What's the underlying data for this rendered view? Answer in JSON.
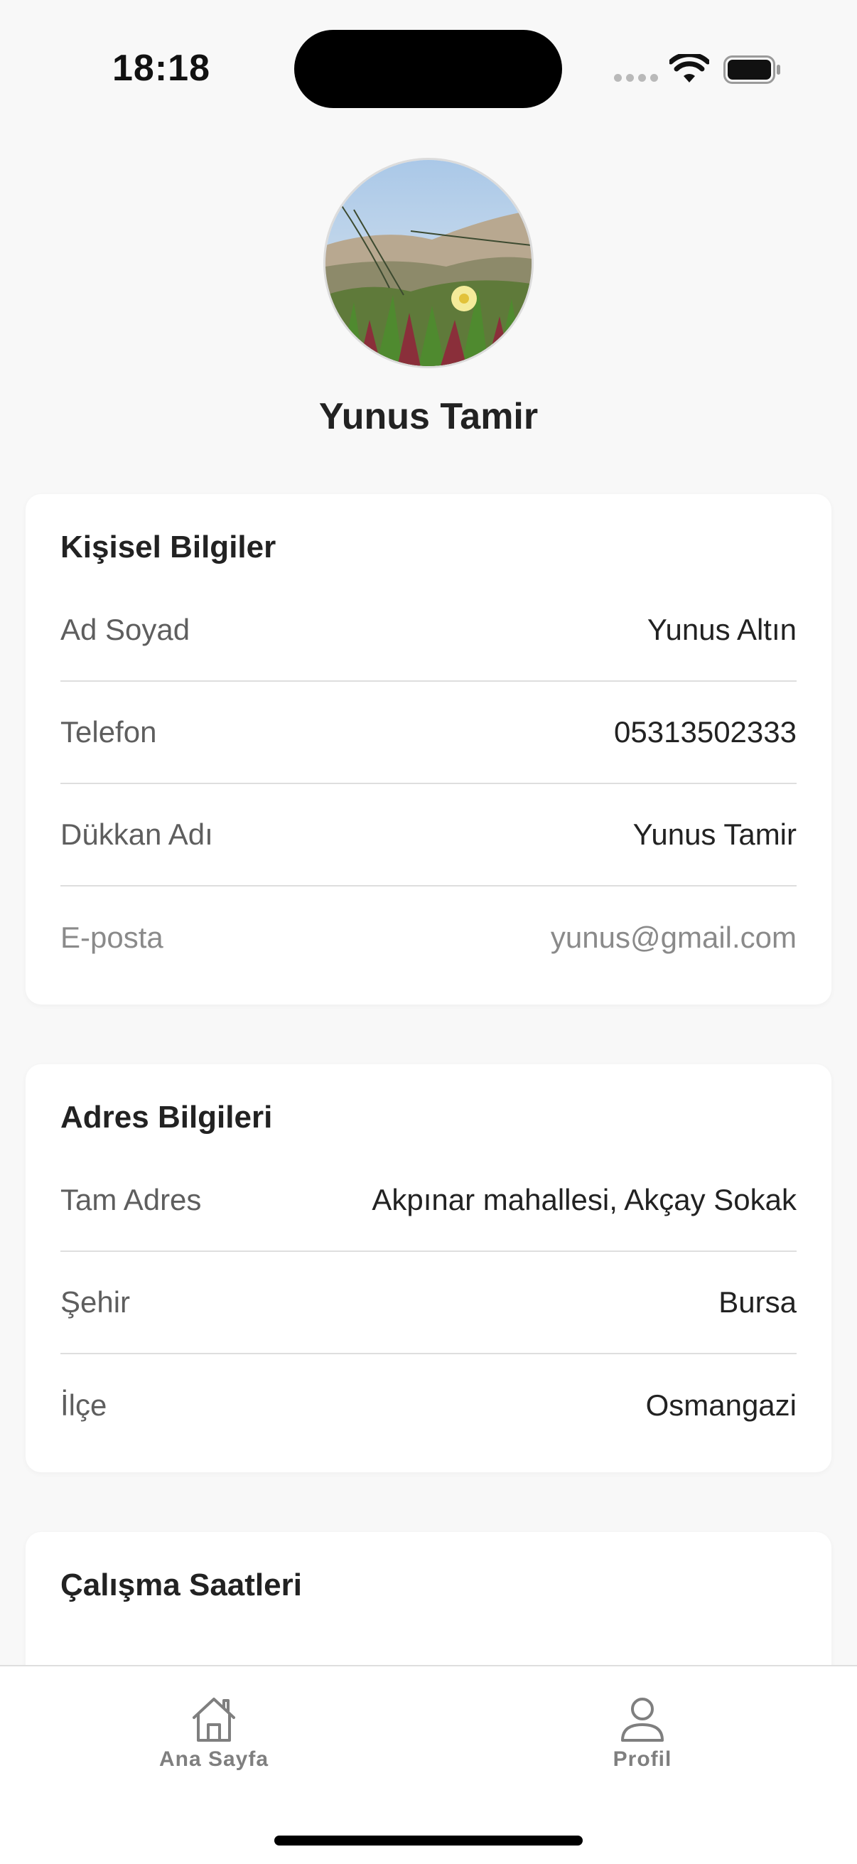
{
  "status_bar": {
    "time": "18:18"
  },
  "profile": {
    "name": "Yunus Tamir"
  },
  "personal": {
    "title": "Kişisel Bilgiler",
    "rows": [
      {
        "label": "Ad Soyad",
        "value": "Yunus Altın"
      },
      {
        "label": "Telefon",
        "value": "05313502333"
      },
      {
        "label": "Dükkan Adı",
        "value": "Yunus Tamir"
      },
      {
        "label": "E-posta",
        "value": "yunus@gmail.com"
      }
    ]
  },
  "address": {
    "title": "Adres Bilgileri",
    "rows": [
      {
        "label": "Tam Adres",
        "value": "Akpınar mahallesi, Akçay Sokak"
      },
      {
        "label": "Şehir",
        "value": "Bursa"
      },
      {
        "label": "İlçe",
        "value": "Osmangazi"
      }
    ]
  },
  "hours": {
    "title": "Çalışma Saatleri"
  },
  "tabs": [
    {
      "label": "Ana Sayfa",
      "icon": "home-icon"
    },
    {
      "label": "Profil",
      "icon": "person-icon"
    }
  ],
  "colors": {
    "background": "#f8f8f8",
    "card": "#ffffff",
    "text": "#222222",
    "muted": "#8a8a8a",
    "divider": "#dedede"
  }
}
